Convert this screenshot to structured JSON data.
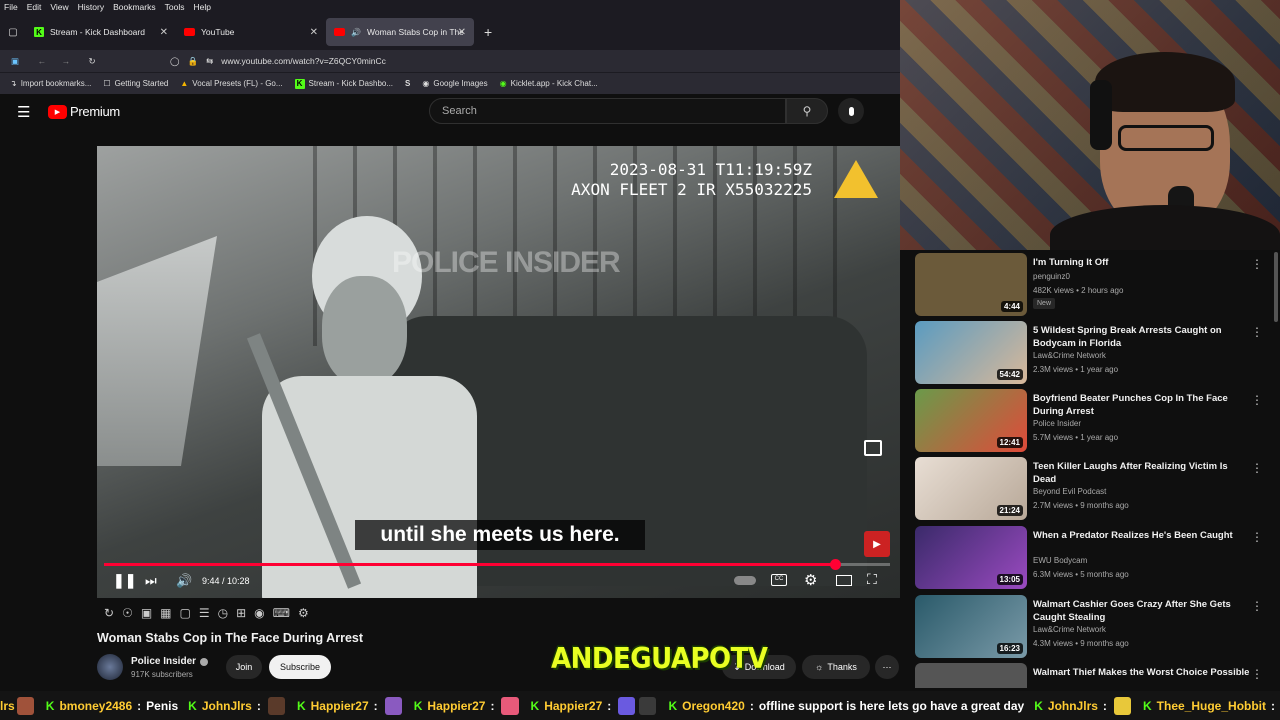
{
  "browser": {
    "menu": [
      "File",
      "Edit",
      "View",
      "History",
      "Bookmarks",
      "Tools",
      "Help"
    ],
    "tabs": [
      {
        "label": "Stream - Kick Dashboard",
        "icon": "kick-icon"
      },
      {
        "label": "YouTube",
        "icon": "youtube-icon"
      },
      {
        "label": "Woman Stabs Cop in The F",
        "icon": "youtube-icon",
        "active": true
      }
    ],
    "url": "www.youtube.com/watch?v=Z6QCY0minCc",
    "bookmarks": [
      "Import bookmarks...",
      "Getting Started",
      "Vocal Presets (FL) - Go...",
      "Stream - Kick Dashbo...",
      "Google Images",
      "Kicklet.app - Kick Chat..."
    ]
  },
  "youtube": {
    "logo_text": "Premium",
    "search_placeholder": "Search"
  },
  "video": {
    "overlay_timestamp": "2023-08-31 T11:19:59Z",
    "overlay_device": "AXON FLEET 2 IR X55032225",
    "watermark": "POLICE INSIDER",
    "subtitle": "until she meets us here.",
    "time_display": "9:44 / 10:28",
    "progress": 0.93,
    "title": "Woman Stabs Cop in The Face During Arrest"
  },
  "channel": {
    "name": "Police Insider",
    "subscribers": "917K subscribers",
    "join_label": "Join",
    "subscribe_label": "Subscribe",
    "download_label": "Download",
    "thanks_label": "Thanks"
  },
  "recommendations": [
    {
      "title": "I'm Turning It Off",
      "channel": "penguinz0",
      "meta": "482K views • 2 hours ago",
      "duration": "4:44",
      "badge": "New",
      "thumb": "#6b5a3a"
    },
    {
      "title": "5 Wildest Spring Break Arrests Caught on Bodycam in Florida",
      "channel": "Law&Crime Network",
      "meta": "2.3M views • 1 year ago",
      "duration": "54:42",
      "thumb": "#4a7d9a"
    },
    {
      "title": "Boyfriend Beater Punches Cop In The Face During Arrest",
      "channel": "Police Insider",
      "meta": "5.7M views • 1 year ago",
      "duration": "12:41",
      "thumb": "#b84a3a"
    },
    {
      "title": "Teen Killer Laughs After Realizing Victim Is Dead",
      "channel": "Beyond Evil Podcast",
      "meta": "2.7M views • 9 months ago",
      "duration": "21:24",
      "thumb": "#c9b8a8"
    },
    {
      "title": "When a Predator Realizes He's Been Caught",
      "channel": "EWU Bodycam",
      "meta": "6.3M views • 5 months ago",
      "duration": "13:05",
      "thumb": "#5a3a8a"
    },
    {
      "title": "Walmart Cashier Goes Crazy After She Gets Caught Stealing",
      "channel": "Law&Crime Network",
      "meta": "4.3M views • 9 months ago",
      "duration": "16:23",
      "thumb": "#3a6a7a"
    },
    {
      "title": "Walmart Thief Makes the Worst Choice Possible",
      "channel": "",
      "meta": "",
      "duration": "",
      "thumb": "#555"
    }
  ],
  "stream_overlay": {
    "brand": "ANDEGUAPOTV"
  },
  "chat": [
    {
      "user": "lrs",
      "msg": ""
    },
    {
      "user": "bmoney2486",
      "msg": "Penis"
    },
    {
      "user": "JohnJlrs",
      "msg": ""
    },
    {
      "user": "Happier27",
      "msg": ""
    },
    {
      "user": "Happier27",
      "msg": ""
    },
    {
      "user": "Happier27",
      "msg": ""
    },
    {
      "user": "Oregon420",
      "msg": "offline support is here lets go have a great day"
    },
    {
      "user": "JohnJlrs",
      "msg": ""
    },
    {
      "user": "Thee_Huge_Hobbit",
      "msg": ""
    }
  ],
  "colors": {
    "kick_green": "#53fc18",
    "yt_red": "#ff0000",
    "progress_red": "#ff0033",
    "chat_user": "#ffcc33",
    "brand_yellow": "#e8ff22"
  }
}
